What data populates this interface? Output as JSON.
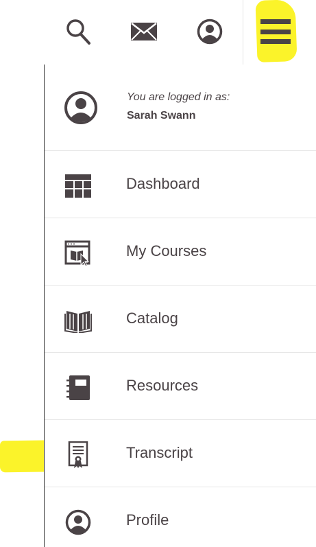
{
  "header": {
    "icons": [
      "search-icon",
      "mail-icon",
      "account-icon",
      "hamburger-menu-icon"
    ]
  },
  "user": {
    "logged_in_label": "You are logged in as:",
    "name": "Sarah Swann",
    "icon": "avatar-icon"
  },
  "menu": {
    "items": [
      {
        "label": "Dashboard",
        "icon": "dashboard-grid-icon"
      },
      {
        "label": "My Courses",
        "icon": "my-courses-icon"
      },
      {
        "label": "Catalog",
        "icon": "catalog-book-icon"
      },
      {
        "label": "Resources",
        "icon": "resources-notebook-icon"
      },
      {
        "label": "Transcript",
        "icon": "transcript-certificate-icon"
      },
      {
        "label": "Profile",
        "icon": "profile-avatar-icon"
      }
    ]
  },
  "colors": {
    "icon": "#4a4346",
    "highlight": "#fbf32a",
    "divider": "#e6e6e6"
  }
}
